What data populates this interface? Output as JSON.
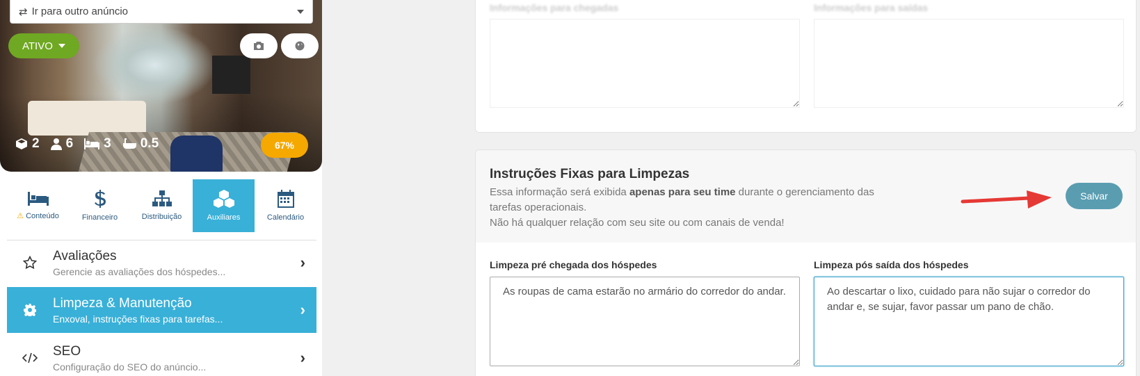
{
  "listing": {
    "goto_label": "Ir para outro anúncio",
    "status": "ATIVO",
    "stats": {
      "rooms": "2",
      "guests": "6",
      "beds": "3",
      "baths": "0.5"
    },
    "completion": "67%"
  },
  "tabs": [
    {
      "label": "Conteúdo",
      "icon": "bed-icon"
    },
    {
      "label": "Financeiro",
      "icon": "dollar-icon"
    },
    {
      "label": "Distribuição",
      "icon": "sitemap-icon"
    },
    {
      "label": "Auxiliares",
      "icon": "cubes-icon"
    },
    {
      "label": "Calendário",
      "icon": "calendar-icon"
    }
  ],
  "menu": [
    {
      "title": "Avaliações",
      "subtitle": "Gerencie as avaliações dos hóspedes...",
      "icon": "star-icon"
    },
    {
      "title": "Limpeza & Manutenção",
      "subtitle": "Enxoval, instruções fixas para tarefas...",
      "icon": "gear-icon"
    },
    {
      "title": "SEO",
      "subtitle": "Configuração do SEO do anúncio...",
      "icon": "code-icon"
    }
  ],
  "top_card": {
    "left_label": "Informações para chegadas",
    "right_label": "Informações para saídas"
  },
  "cleaning": {
    "title": "Instruções Fixas para Limpezas",
    "desc_pre": "Essa informação será exibida ",
    "desc_bold": "apenas para seu time",
    "desc_post": " durante o gerenciamento das tarefas operacionais.",
    "desc_line2": "Não há qualquer relação com seu site ou com canais de venda!",
    "save_label": "Salvar",
    "pre_label": "Limpeza pré chegada dos hóspedes",
    "pre_value": "As roupas de cama estarão no armário do corredor do andar.",
    "post_label": "Limpeza pós saída dos hóspedes",
    "post_value": "Ao descartar o lixo, cuidado para não sujar o corredor do andar e, se sujar, favor passar um pano de chão."
  },
  "colors": {
    "accent": "#39b0d8",
    "status_green": "#6fa822",
    "badge_orange": "#f5a800",
    "save": "#5a9db1",
    "arrow": "#e53935"
  }
}
